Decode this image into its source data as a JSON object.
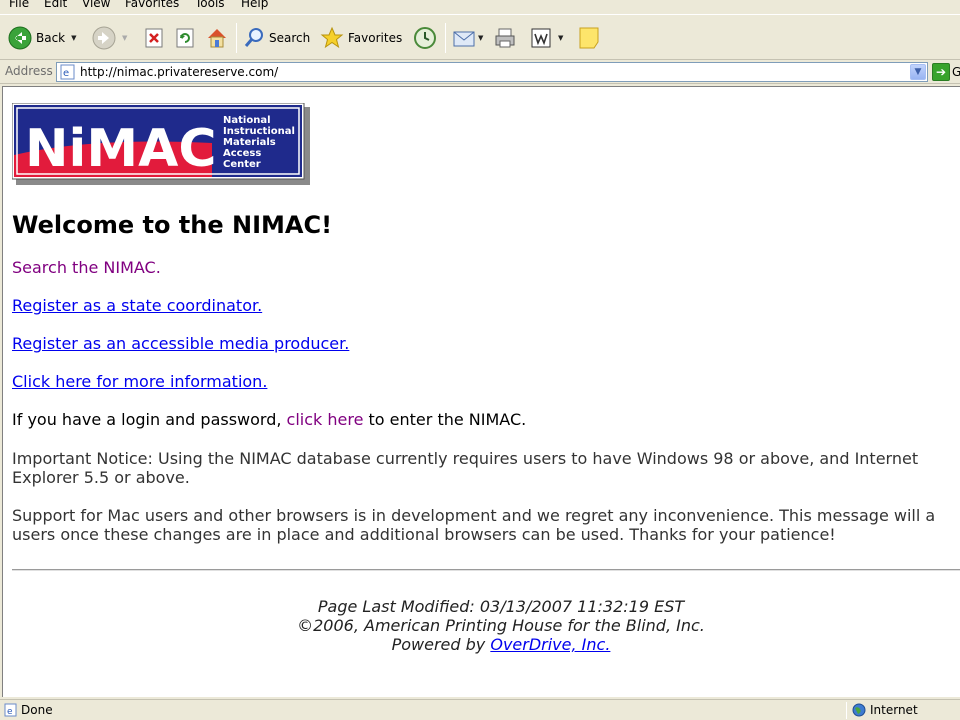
{
  "menu": [
    "File",
    "Edit",
    "View",
    "Favorites",
    "Tools",
    "Help"
  ],
  "toolbar": {
    "back_label": "Back",
    "search_label": "Search",
    "favorites_label": "Favorites"
  },
  "address": {
    "label": "Address",
    "url": "http://nimac.privatereserve.com/",
    "go_label": "G"
  },
  "logo": {
    "acronym": "NiMAC",
    "line1": "National",
    "line2": "Instructional",
    "line3": "Materials",
    "line4": "Access",
    "line5": "Center"
  },
  "page": {
    "heading": "Welcome to the NIMAC!",
    "link_search": "Search the NIMAC.",
    "link_state": "Register as a state coordinator.",
    "link_producer": "Register as an accessible media producer.",
    "link_info": "Click here for more information.",
    "login_pre": "If you have a login and password, ",
    "login_link": "click here",
    "login_post": " to enter the NIMAC.",
    "notice1": "Important Notice: Using the NIMAC database currently requires users to have Windows 98 or above, and Internet Explorer 5.5 or above.",
    "notice2": "Support for Mac users and other browsers is in development and we regret any inconvenience. This message will a users once these changes are in place and additional browsers can be used. Thanks for your patience!"
  },
  "footer": {
    "modified": "Page Last Modified: 03/13/2007 11:32:19 EST",
    "copyright": "©2006, American Printing House for the Blind, Inc.",
    "powered_pre": "Powered by ",
    "powered_link": "OverDrive, Inc."
  },
  "status": {
    "text": "Done",
    "zone": "Internet"
  },
  "colors": {
    "link": "#0000ee",
    "visited": "#800080",
    "logo_blue": "#1f2a8c",
    "logo_red": "#e21b3c"
  }
}
